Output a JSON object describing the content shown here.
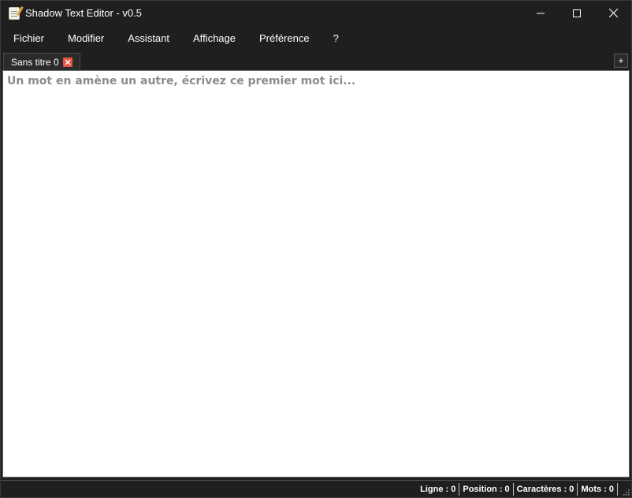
{
  "window": {
    "title": "Shadow Text Editor - v0.5",
    "icon": "notepad-icon",
    "controls": [
      "minimize-icon",
      "maximize-icon",
      "close-icon"
    ]
  },
  "menu": [
    {
      "label": "Fichier"
    },
    {
      "label": "Modifier"
    },
    {
      "label": "Assistant"
    },
    {
      "label": "Affichage"
    },
    {
      "label": "Préférence"
    },
    {
      "label": "?"
    }
  ],
  "tabs": [
    {
      "label": "Sans titre 0",
      "close_icon": "close-icon",
      "active": true
    }
  ],
  "new_tab_label": "+",
  "editor": {
    "value": "",
    "placeholder": "Un mot en amène un autre, écrivez ce premier mot ici..."
  },
  "status": {
    "line": "Ligne : 0",
    "position": "Position : 0",
    "characters": "Caractères : 0",
    "words": "Mots : 0"
  },
  "colors": {
    "background": "#1f1f1f",
    "editor_background": "#ffffff",
    "placeholder": "#8c8c8c",
    "tab_close": "#e8553e"
  }
}
